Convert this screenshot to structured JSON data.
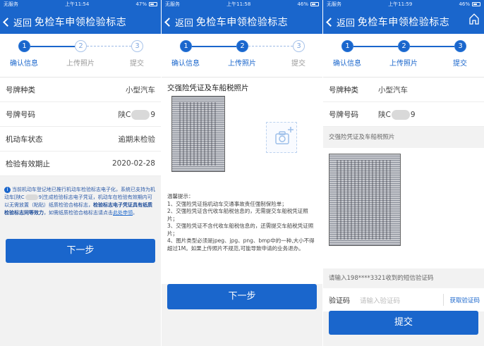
{
  "common": {
    "carrier": "无服务",
    "back_label": "返回",
    "page_title": "免检车申领检验标志",
    "steps": [
      "确认信息",
      "上传照片",
      "提交"
    ],
    "step_nums": [
      "1",
      "2",
      "3"
    ],
    "colors": {
      "primary": "#1a66cc",
      "inactive": "#999999",
      "page_bg": "#f2f2f2"
    }
  },
  "screen1": {
    "time": "上午11:54",
    "battery": "47%",
    "rows": [
      {
        "label": "号牌种类",
        "value": "小型汽车"
      },
      {
        "label": "号牌号码",
        "value_prefix": "陕C",
        "value_suffix": "9"
      },
      {
        "label": "机动车状态",
        "value": "逾期未检验"
      },
      {
        "label": "检验有效期止",
        "value": "2020-02-28"
      }
    ],
    "notice": {
      "icon": "i",
      "p1": "当前机动车登记地已推行机动车检验标志电子化，系统已支持为机动车[陕C",
      "p2": "9]生成检验标志电子凭证，机动车在检验有效期内可以无需放置（粘贴）纸质检验合格标志，",
      "bold": "检验标志电子凭证具有纸质检验标志同等效力",
      "p3": "，如需纸质检验合格标志请点击",
      "link": "此处申领",
      "end": "。"
    },
    "next_label": "下一步"
  },
  "screen2": {
    "time": "上午11:58",
    "battery": "46%",
    "section_title": "交强险凭证及车船税照片",
    "tips_title": "温馨提示：",
    "tips": [
      "1、交强险凭证指机动车交通事故责任强制保险单；",
      "2、交强险凭证含代收车船税信息的，无需提交车船税凭证照片；",
      "3、交强险凭证不含代收车船税信息的，还需提交车船税凭证照片；",
      "4、图片类型必须是jpeg、jpg、png、bmp中的一种,大小不得超过1M。如果上传照片不规范,可能导致申请的业务退办。"
    ],
    "next_label": "下一步"
  },
  "screen3": {
    "time": "上午11:59",
    "battery": "46%",
    "rows": [
      {
        "label": "号牌种类",
        "value": "小型汽车"
      },
      {
        "label": "号牌号码",
        "value_prefix": "陕C",
        "value_suffix": "9"
      }
    ],
    "photo_title": "交强险凭证及车船税照片",
    "sms_hint": "请输入198****3321收到的短信验证码",
    "code_label": "验证码",
    "code_placeholder": "请输入验证码",
    "get_code_label": "获取验证码",
    "submit_label": "提交"
  }
}
